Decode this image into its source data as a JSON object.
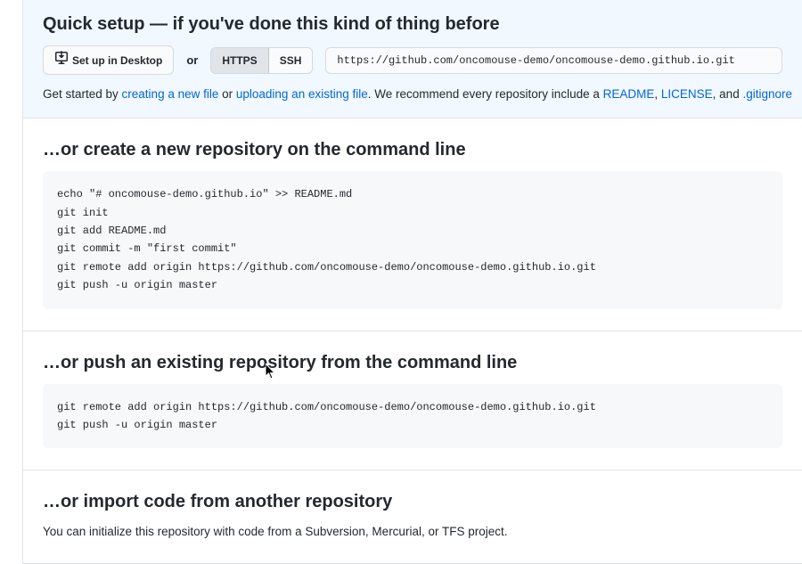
{
  "quickSetup": {
    "heading": "Quick setup — if you've done this kind of thing before",
    "setupDesktopLabel": "Set up in Desktop",
    "orText": "or",
    "httpsLabel": "HTTPS",
    "sshLabel": "SSH",
    "cloneUrl": "https://github.com/oncomouse-demo/oncomouse-demo.github.io.git",
    "helpPrefix": "Get started by ",
    "createFileLink": "creating a new file",
    "helpOr": " or ",
    "uploadFileLink": "uploading an existing file",
    "helpMiddle": ". We recommend every repository include a ",
    "readmeLink": "README",
    "helpComma": ", ",
    "licenseLink": "LICENSE",
    "helpAnd": ", and ",
    "gitignoreLink": ".gitignore"
  },
  "createSection": {
    "heading": "…or create a new repository on the command line",
    "code": "echo \"# oncomouse-demo.github.io\" >> README.md\ngit init\ngit add README.md\ngit commit -m \"first commit\"\ngit remote add origin https://github.com/oncomouse-demo/oncomouse-demo.github.io.git\ngit push -u origin master"
  },
  "pushSection": {
    "heading": "…or push an existing repository from the command line",
    "code": "git remote add origin https://github.com/oncomouse-demo/oncomouse-demo.github.io.git\ngit push -u origin master"
  },
  "importSection": {
    "heading": "…or import code from another repository",
    "text": "You can initialize this repository with code from a Subversion, Mercurial, or TFS project."
  }
}
